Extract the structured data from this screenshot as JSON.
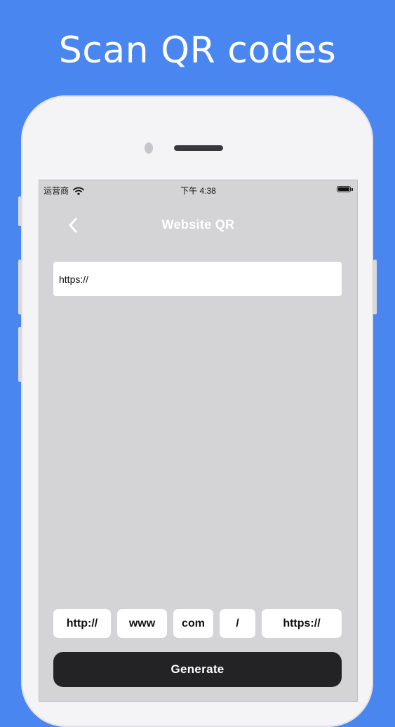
{
  "headline": "Scan QR codes",
  "status_bar": {
    "carrier": "运营商",
    "time": "下午 4:38"
  },
  "nav": {
    "back_icon": "chevron-left-icon",
    "title": "Website QR"
  },
  "url_input": {
    "value": "https://"
  },
  "shortcuts": [
    "http://",
    "www",
    "com",
    "/",
    "https://"
  ],
  "generate_label": "Generate",
  "colors": {
    "background": "#4a86ef",
    "screen": "#d4d3d6",
    "button": "#232325"
  }
}
